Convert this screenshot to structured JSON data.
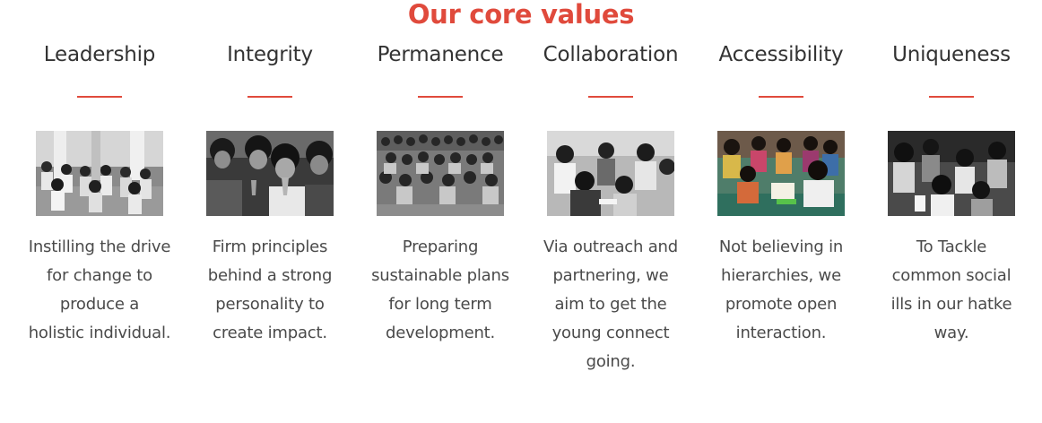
{
  "section": {
    "title": "Our core values",
    "accent_color": "#e04a3c"
  },
  "values": [
    {
      "heading": "Leadership",
      "image_icon": "students-seated-in-rows-photo",
      "image_tone": "grayscale",
      "lines": [
        "Instilling the drive",
        "for change to",
        "produce a",
        "holistic individual."
      ]
    },
    {
      "heading": "Integrity",
      "image_icon": "children-praying-photo",
      "image_tone": "grayscale",
      "lines": [
        "Firm principles",
        "behind a strong",
        "personality to",
        "create impact."
      ]
    },
    {
      "heading": "Permanence",
      "image_icon": "crowd-of-students-photo",
      "image_tone": "grayscale",
      "lines": [
        "Preparing",
        "sustainable plans",
        "for long term",
        "development."
      ]
    },
    {
      "heading": "Collaboration",
      "image_icon": "group-activity-photo",
      "image_tone": "grayscale",
      "lines": [
        "Via outreach and",
        "partnering, we",
        "aim to get the",
        "young connect",
        "going."
      ]
    },
    {
      "heading": "Accessibility",
      "image_icon": "children-reading-with-mentor-photo",
      "image_tone": "color",
      "lines": [
        "Not believing in",
        "hierarchies, we",
        "promote open",
        "interaction."
      ]
    },
    {
      "heading": "Uniqueness",
      "image_icon": "children-playing-photo",
      "image_tone": "grayscale",
      "lines": [
        "To Tackle",
        "common social",
        "ills in our hatke",
        "way."
      ]
    }
  ]
}
